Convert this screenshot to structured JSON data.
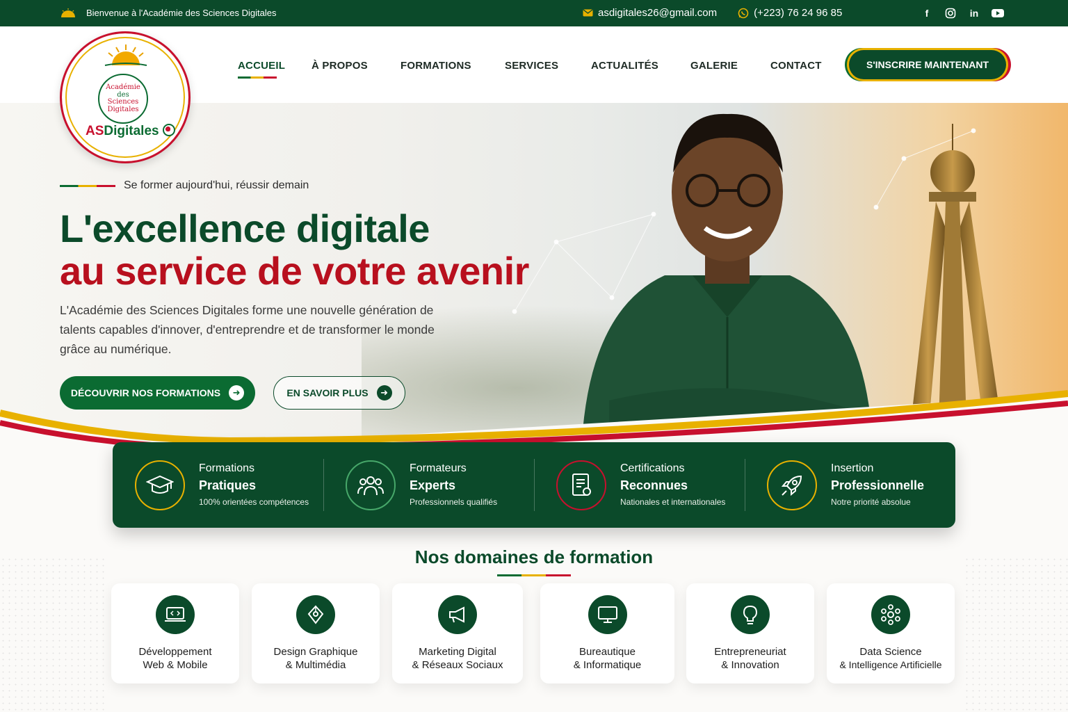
{
  "topbar": {
    "welcome": "Bienvenue à l'Académie des Sciences Digitales",
    "email": "asdigitales26@gmail.com",
    "phone": "(+223) 76 24 96 85",
    "social": [
      "facebook-icon",
      "instagram-icon",
      "linkedin-icon",
      "youtube-icon"
    ]
  },
  "logo": {
    "ring_line1": "Académie",
    "ring_line2": "des",
    "ring_line3": "Sciences",
    "ring_line4": "Digitales",
    "brand_as": "AS",
    "brand_rest": "Digitales"
  },
  "nav": {
    "items": [
      "ACCUEIL",
      "À PROPOS",
      "FORMATIONS",
      "SERVICES",
      "ACTUALITÉS",
      "GALERIE",
      "CONTACT"
    ],
    "active": "ACCUEIL",
    "cta": "S'INSCRIRE MAINTENANT"
  },
  "hero": {
    "tagline": "Se former aujourd'hui, réussir demain",
    "title_line1": "L'excellence digitale",
    "title_line2": "au service de votre avenir",
    "description": "L'Académie des Sciences Digitales forme une nouvelle génération de talents capables d'innover, d'entreprendre et de transformer le monde grâce au numérique.",
    "btn_primary": "DÉCOUVRIR NOS FORMATIONS",
    "btn_secondary": "EN SAVOIR PLUS"
  },
  "features": [
    {
      "line1": "Formations",
      "line2": "Pratiques",
      "line3": "100% orientées compétences",
      "icon": "graduation-cap-icon"
    },
    {
      "line1": "Formateurs",
      "line2": "Experts",
      "line3": "Professionnels qualifiés",
      "icon": "team-icon"
    },
    {
      "line1": "Certifications",
      "line2": "Reconnues",
      "line3": "Nationales et internationales",
      "icon": "certificate-icon"
    },
    {
      "line1": "Insertion",
      "line2": "Professionnelle",
      "line3": "Notre priorité absolue",
      "icon": "rocket-icon"
    }
  ],
  "domains": {
    "title": "Nos domaines de formation",
    "items": [
      {
        "line1": "Développement",
        "line2": "Web & Mobile",
        "icon": "laptop-code-icon"
      },
      {
        "line1": "Design Graphique",
        "line2": "& Multimédia",
        "icon": "pen-tool-icon"
      },
      {
        "line1": "Marketing Digital",
        "line2": "& Réseaux Sociaux",
        "icon": "megaphone-icon"
      },
      {
        "line1": "Bureautique",
        "line2": "& Informatique",
        "icon": "monitor-icon"
      },
      {
        "line1": "Entrepreneuriat",
        "line2": "& Innovation",
        "icon": "lightbulb-icon"
      },
      {
        "line1": "Data Science",
        "line2": "& Intelligence Artificielle",
        "icon": "network-icon"
      }
    ]
  },
  "colors": {
    "primary_green": "#0b4a2a",
    "accent_green": "#0b6b32",
    "accent_yellow": "#e8b100",
    "accent_red": "#c8102e"
  }
}
